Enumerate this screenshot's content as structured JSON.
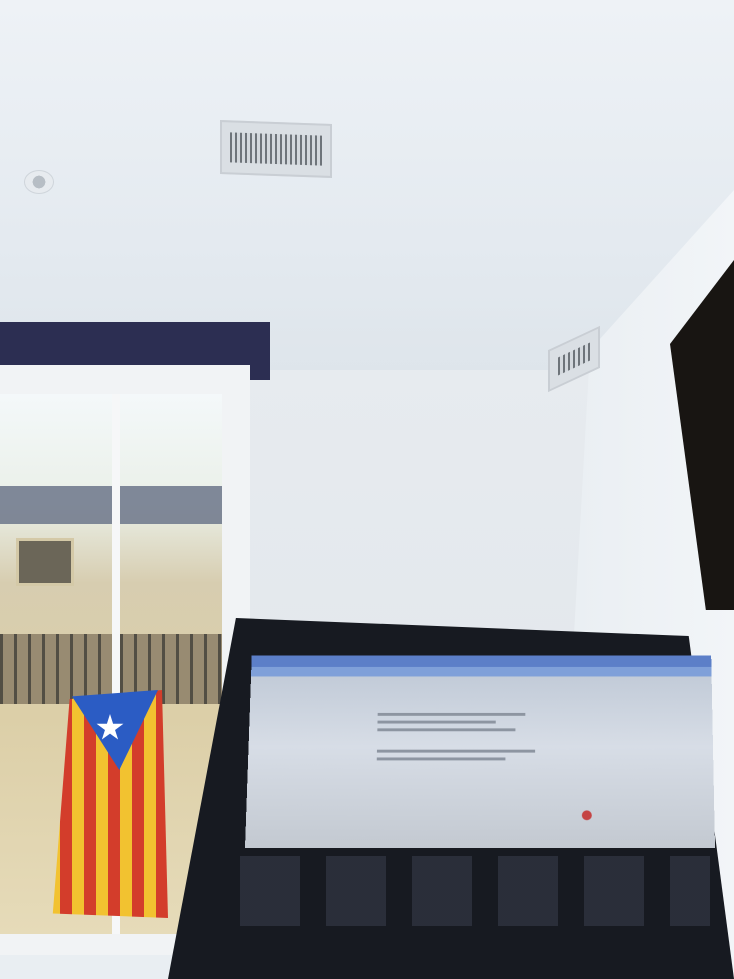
{
  "scene": {
    "colors": {
      "ceiling": "#eef2f6",
      "wall": "#e3e8ec",
      "window_head": "#2c2e52",
      "laptop": "#171a21",
      "flag_yellow": "#f2c230",
      "flag_red": "#d33d2b",
      "flag_blue": "#2b5cc4"
    }
  }
}
